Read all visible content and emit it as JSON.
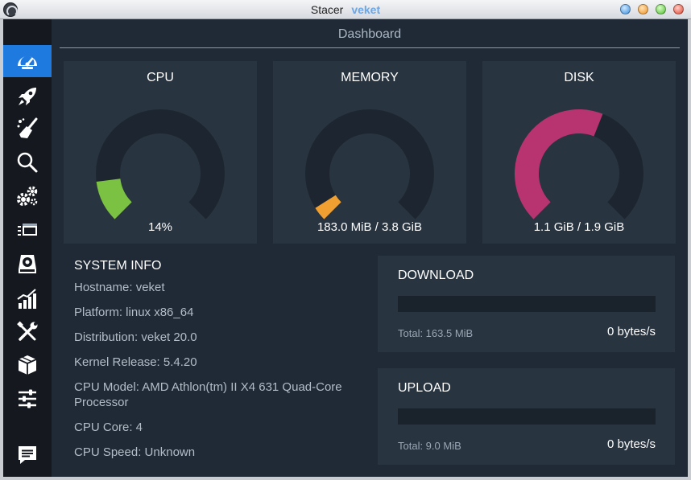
{
  "window": {
    "title_app": "Stacer",
    "title_host": "veket"
  },
  "sidebar": {
    "items": [
      {
        "id": "dashboard",
        "icon": "speedometer-icon",
        "active": true
      },
      {
        "id": "startup",
        "icon": "rocket-icon",
        "active": false
      },
      {
        "id": "cleaner",
        "icon": "broom-icon",
        "active": false
      },
      {
        "id": "search",
        "icon": "magnifier-icon",
        "active": false
      },
      {
        "id": "services",
        "icon": "gears-icon",
        "active": false
      },
      {
        "id": "processes",
        "icon": "windows-stack-icon",
        "active": false
      },
      {
        "id": "uninstaller",
        "icon": "disc-drive-icon",
        "active": false
      },
      {
        "id": "resources",
        "icon": "bar-chart-icon",
        "active": false
      },
      {
        "id": "helpers",
        "icon": "wrench-screwdriver-icon",
        "active": false
      },
      {
        "id": "apt-repository",
        "icon": "package-box-icon",
        "active": false
      },
      {
        "id": "settings",
        "icon": "sliders-icon",
        "active": false
      },
      {
        "id": "feedback",
        "icon": "chat-bubble-icon",
        "active": false
      }
    ]
  },
  "header": {
    "title": "Dashboard"
  },
  "gauges": [
    {
      "id": "cpu",
      "title": "CPU",
      "value_text": "14%",
      "fraction": 0.14,
      "color": "#7cc242"
    },
    {
      "id": "memory",
      "title": "MEMORY",
      "value_text": "183.0 MiB / 3.8 GiB",
      "fraction": 0.047,
      "color": "#f0a030"
    },
    {
      "id": "disk",
      "title": "DISK",
      "value_text": "1.1 GiB / 1.9 GiB",
      "fraction": 0.58,
      "color": "#b83470"
    }
  ],
  "system_info": {
    "title": "SYSTEM INFO",
    "lines": [
      "Hostname: veket",
      "Platform: linux x86_64",
      "Distribution: veket 20.0",
      "Kernel Release: 5.4.20",
      "CPU Model:  AMD Athlon(tm) II X4 631 Quad-Core Processor",
      "CPU Core: 4",
      "CPU Speed: Unknown"
    ]
  },
  "network": {
    "download": {
      "title": "DOWNLOAD",
      "total": "Total: 163.5 MiB",
      "speed": "0 bytes/s"
    },
    "upload": {
      "title": "UPLOAD",
      "total": "Total: 9.0 MiB",
      "speed": "0 bytes/s"
    }
  },
  "colors": {
    "sidebar_active": "#1f7ae0",
    "card_bg": "#283440",
    "gauge_track": "#1d2630"
  }
}
